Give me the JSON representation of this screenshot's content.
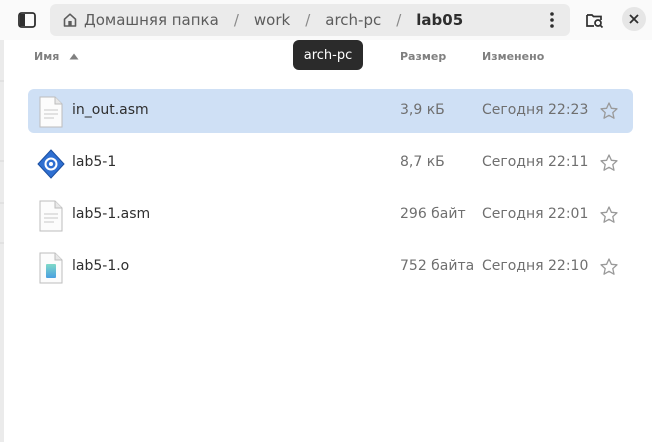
{
  "header": {
    "sidebar_icon": "sidebar-toggle-icon",
    "breadcrumbs": [
      "Домашняя папка",
      "work",
      "arch-pc",
      "lab05"
    ],
    "separator": "/",
    "tooltip": "arch-pc",
    "menu_icon": "vertical-dots-icon",
    "search_icon": "folder-search-icon",
    "close_icon": "close-icon"
  },
  "columns": {
    "name": "Имя",
    "size": "Размер",
    "modified": "Изменено",
    "sort_icon": "sort-ascending-icon"
  },
  "files": [
    {
      "name": "in_out.asm",
      "size": "3,9 кБ",
      "modified": "Сегодня 22:23",
      "icon": "text-file-icon",
      "selected": true
    },
    {
      "name": "lab5-1",
      "size": "8,7 кБ",
      "modified": "Сегодня 22:11",
      "icon": "executable-icon",
      "selected": false
    },
    {
      "name": "lab5-1.asm",
      "size": "296 байт",
      "modified": "Сегодня 22:01",
      "icon": "text-file-icon",
      "selected": false
    },
    {
      "name": "lab5-1.o",
      "size": "752 байта",
      "modified": "Сегодня 22:10",
      "icon": "object-file-icon",
      "selected": false
    }
  ],
  "star_icon": "star-icon",
  "colors": {
    "selection": "#cfe0f5",
    "pathbar": "#ebebeb",
    "tooltip": "#2b2b2b",
    "exec_icon": "#2e6fd1"
  }
}
